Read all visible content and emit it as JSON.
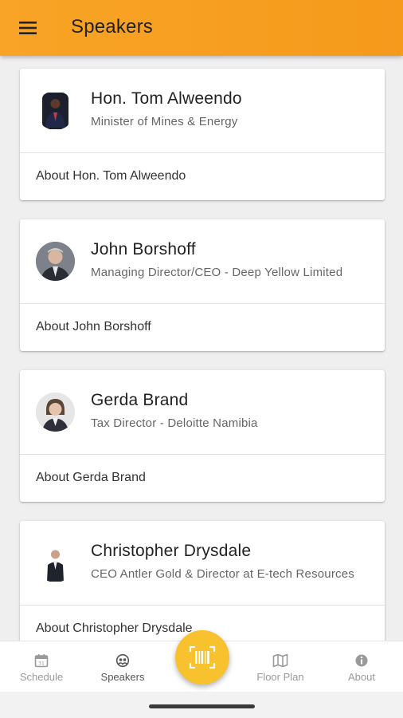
{
  "appbar": {
    "title": "Speakers",
    "color": "#f7a020",
    "menu_icon": "hamburger-menu-icon"
  },
  "speakers": [
    {
      "name": "Hon. Tom Alweendo",
      "role": "Minister of Mines & Energy",
      "about": "About Hon. Tom Alweendo"
    },
    {
      "name": "John Borshoff",
      "role": "Managing Director/CEO - Deep Yellow Limited",
      "about": "About John Borshoff"
    },
    {
      "name": "Gerda Brand",
      "role": "Tax Director - Deloitte Namibia",
      "about": "About Gerda Brand"
    },
    {
      "name": "Christopher Drysdale",
      "role": "CEO Antler Gold & Director at E-tech Resources",
      "about": "About Christopher Drysdale"
    }
  ],
  "bottom_nav": {
    "items": [
      {
        "label": "Schedule",
        "icon": "calendar-icon"
      },
      {
        "label": "Speakers",
        "icon": "speakers-icon",
        "active": true
      },
      {
        "label": "Floor Plan",
        "icon": "map-icon"
      },
      {
        "label": "About",
        "icon": "info-icon"
      }
    ],
    "fab_icon": "barcode-scan-icon",
    "fab_color": "#f8c12e"
  }
}
